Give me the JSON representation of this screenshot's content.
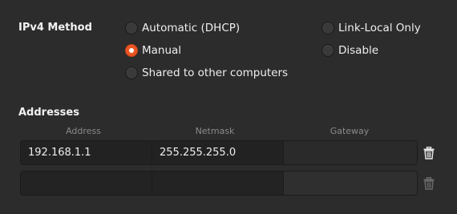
{
  "ipv4_method": {
    "title": "IPv4 Method",
    "options": [
      {
        "label": "Automatic (DHCP)",
        "checked": false
      },
      {
        "label": "Manual",
        "checked": true
      },
      {
        "label": "Shared to other computers",
        "checked": false
      },
      {
        "label": "Link-Local Only",
        "checked": false
      },
      {
        "label": "Disable",
        "checked": false
      }
    ],
    "accent_color": "#e95420"
  },
  "addresses": {
    "title": "Addresses",
    "columns": [
      "Address",
      "Netmask",
      "Gateway"
    ],
    "rows": [
      {
        "address": "192.168.1.1",
        "netmask": "255.255.255.0",
        "gateway": ""
      },
      {
        "address": "",
        "netmask": "",
        "gateway": ""
      }
    ],
    "delete_icon": "trash-icon"
  }
}
